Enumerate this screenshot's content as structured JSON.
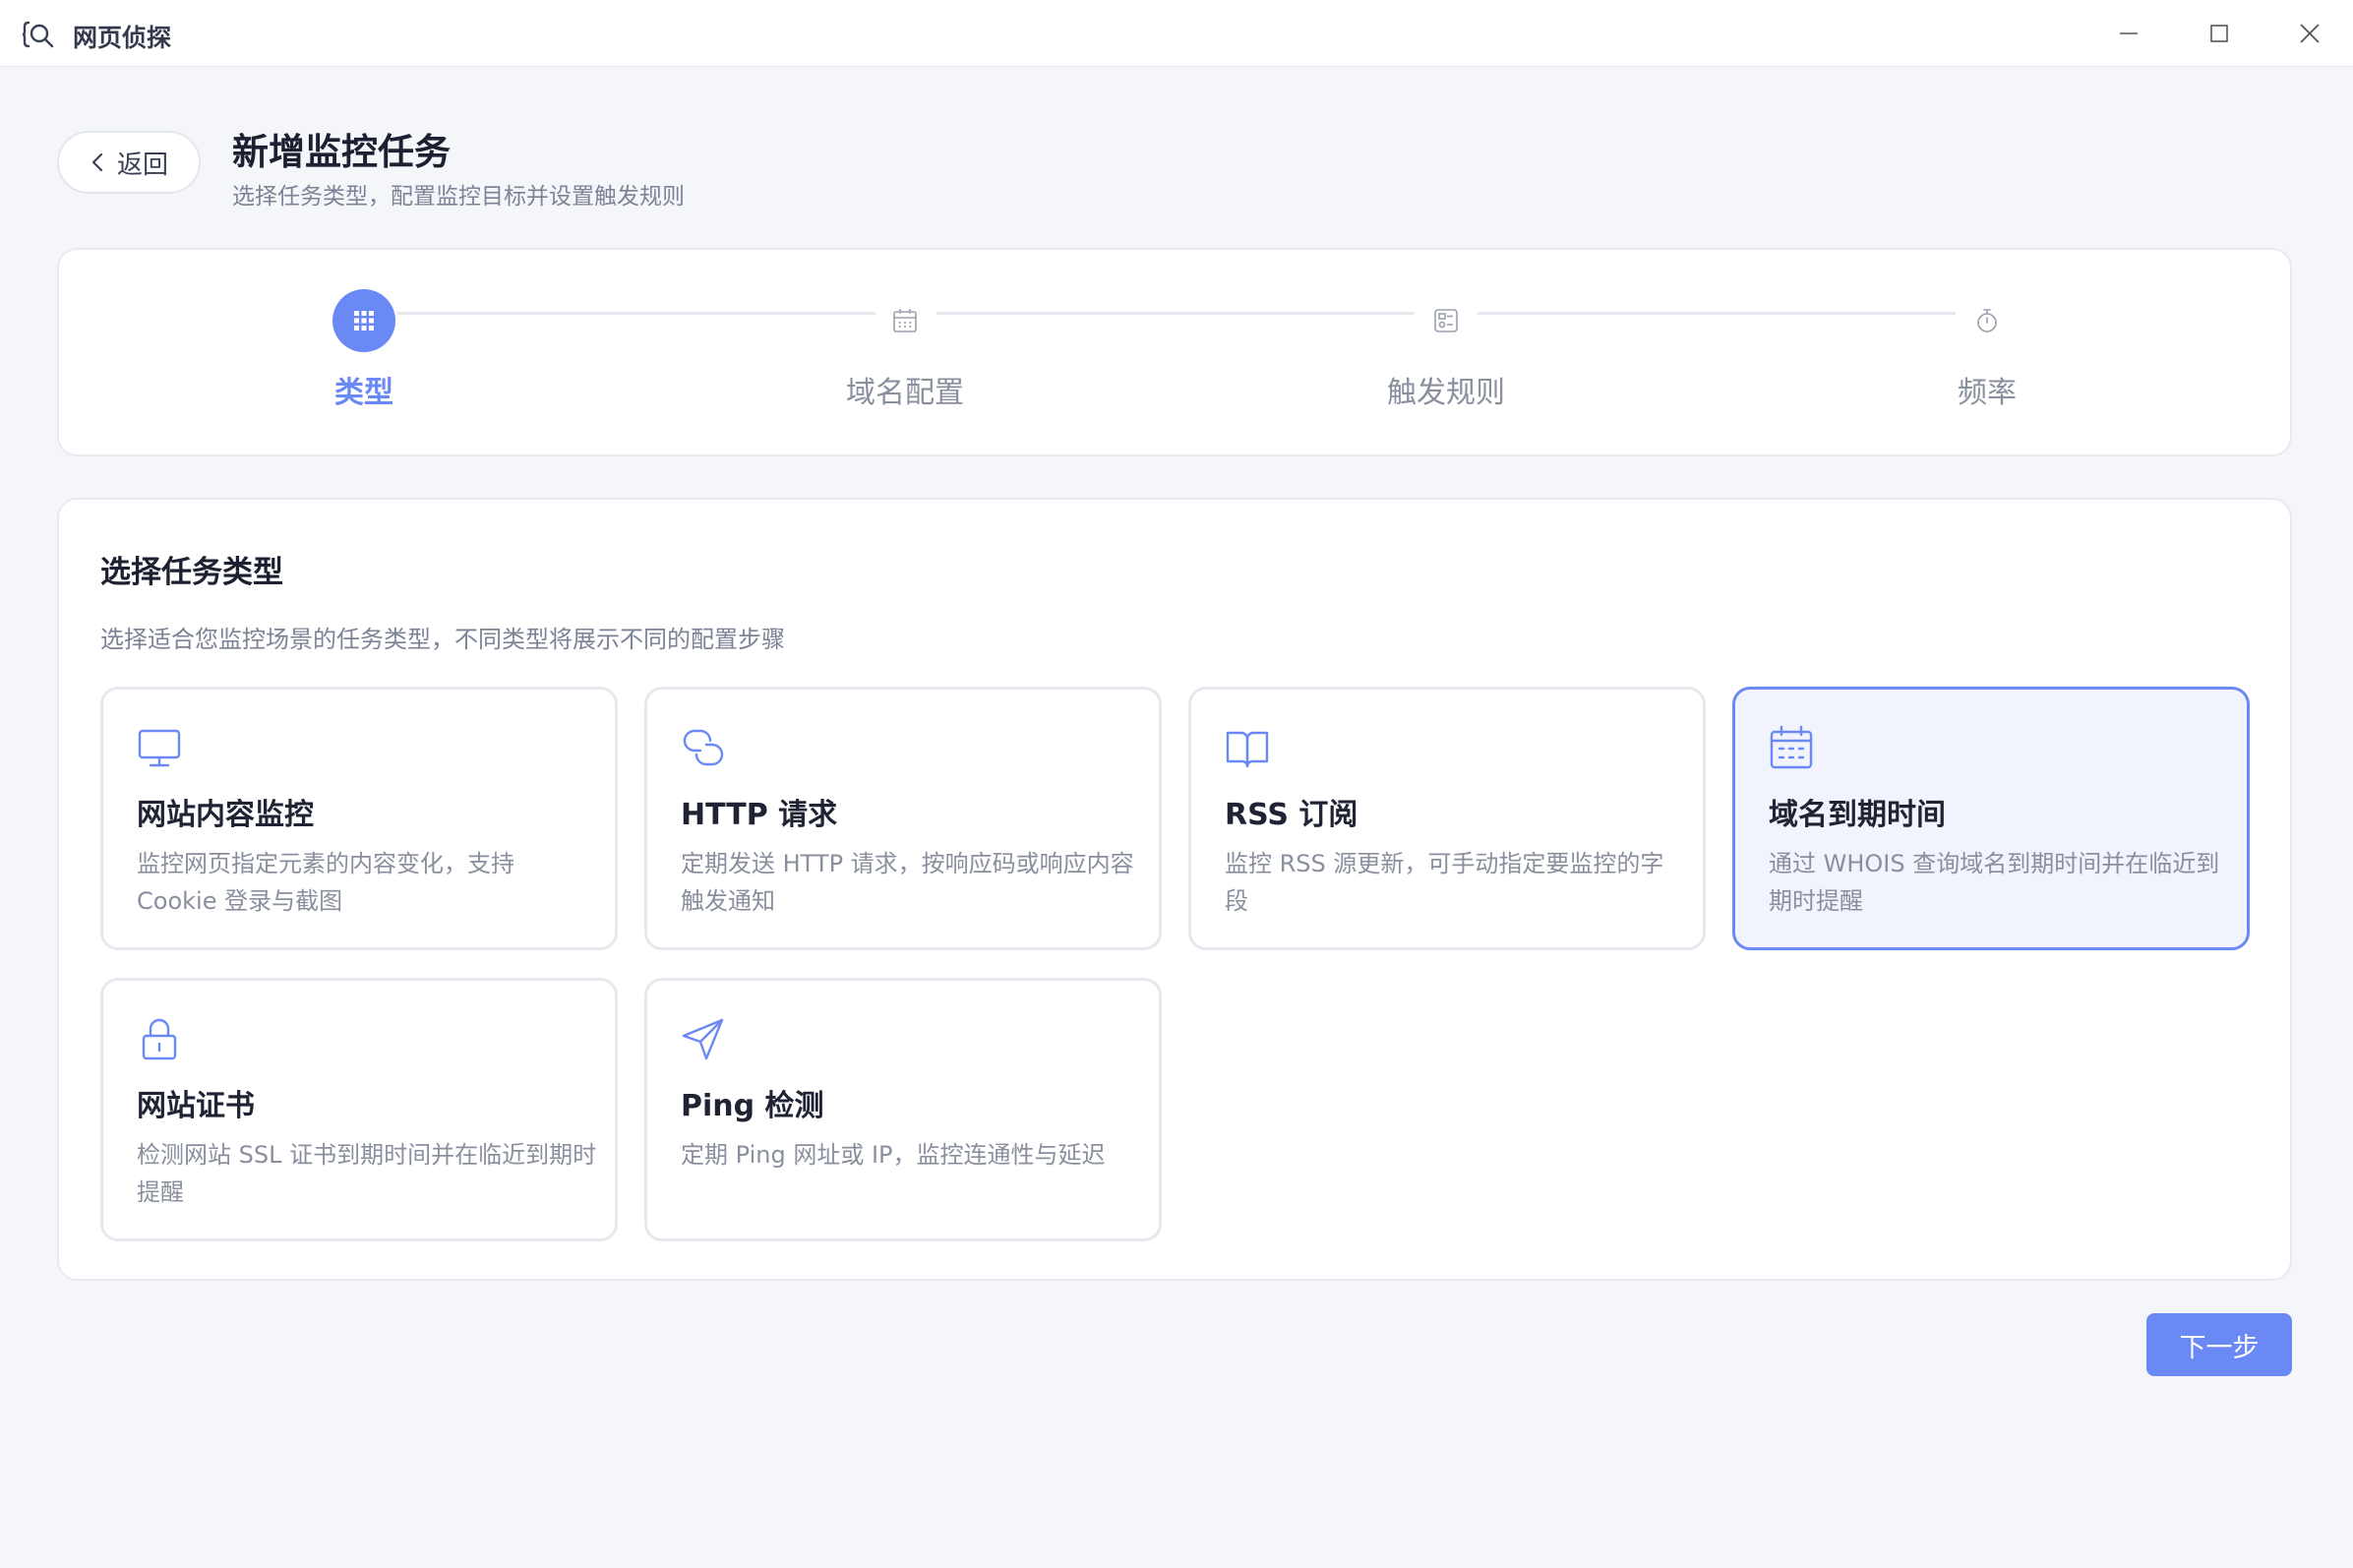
{
  "window": {
    "title": "网页侦探",
    "controls": [
      "minimize-icon",
      "maximize-icon",
      "close-icon"
    ]
  },
  "header": {
    "back_label": "返回",
    "title": "新增监控任务",
    "subtitle": "选择任务类型，配置监控目标并设置触发规则"
  },
  "steps": [
    {
      "label": "类型",
      "icon": "grid-icon",
      "active": true
    },
    {
      "label": "域名配置",
      "icon": "calendar-icon",
      "active": false
    },
    {
      "label": "触发规则",
      "icon": "rules-icon",
      "active": false
    },
    {
      "label": "频率",
      "icon": "timer-icon",
      "active": false
    }
  ],
  "section": {
    "title": "选择任务类型",
    "description": "选择适合您监控场景的任务类型，不同类型将展示不同的配置步骤"
  },
  "task_types": [
    {
      "name": "网站内容监控",
      "desc": "监控网页指定元素的内容变化，支持 Cookie 登录与截图",
      "icon": "monitor-icon",
      "selected": false
    },
    {
      "name": "HTTP 请求",
      "desc": "定期发送 HTTP 请求，按响应码或响应内容触发通知",
      "icon": "link-icon",
      "selected": false
    },
    {
      "name": "RSS 订阅",
      "desc": "监控 RSS 源更新，可手动指定要监控的字段",
      "icon": "book-icon",
      "selected": false
    },
    {
      "name": "域名到期时间",
      "desc": "通过 WHOIS 查询域名到期时间并在临近到期时提醒",
      "icon": "calendar-icon",
      "selected": true
    },
    {
      "name": "网站证书",
      "desc": "检测网站 SSL 证书到期时间并在临近到期时提醒",
      "icon": "lock-icon",
      "selected": false
    },
    {
      "name": "Ping 检测",
      "desc": "定期 Ping 网址或 IP，监控连通性与延迟",
      "icon": "send-icon",
      "selected": false
    }
  ],
  "footer": {
    "next_label": "下一步"
  },
  "colors": {
    "accent": "#6b89f5",
    "selected_bg": "#f1f4fd",
    "page_bg": "#f5f6fa"
  }
}
